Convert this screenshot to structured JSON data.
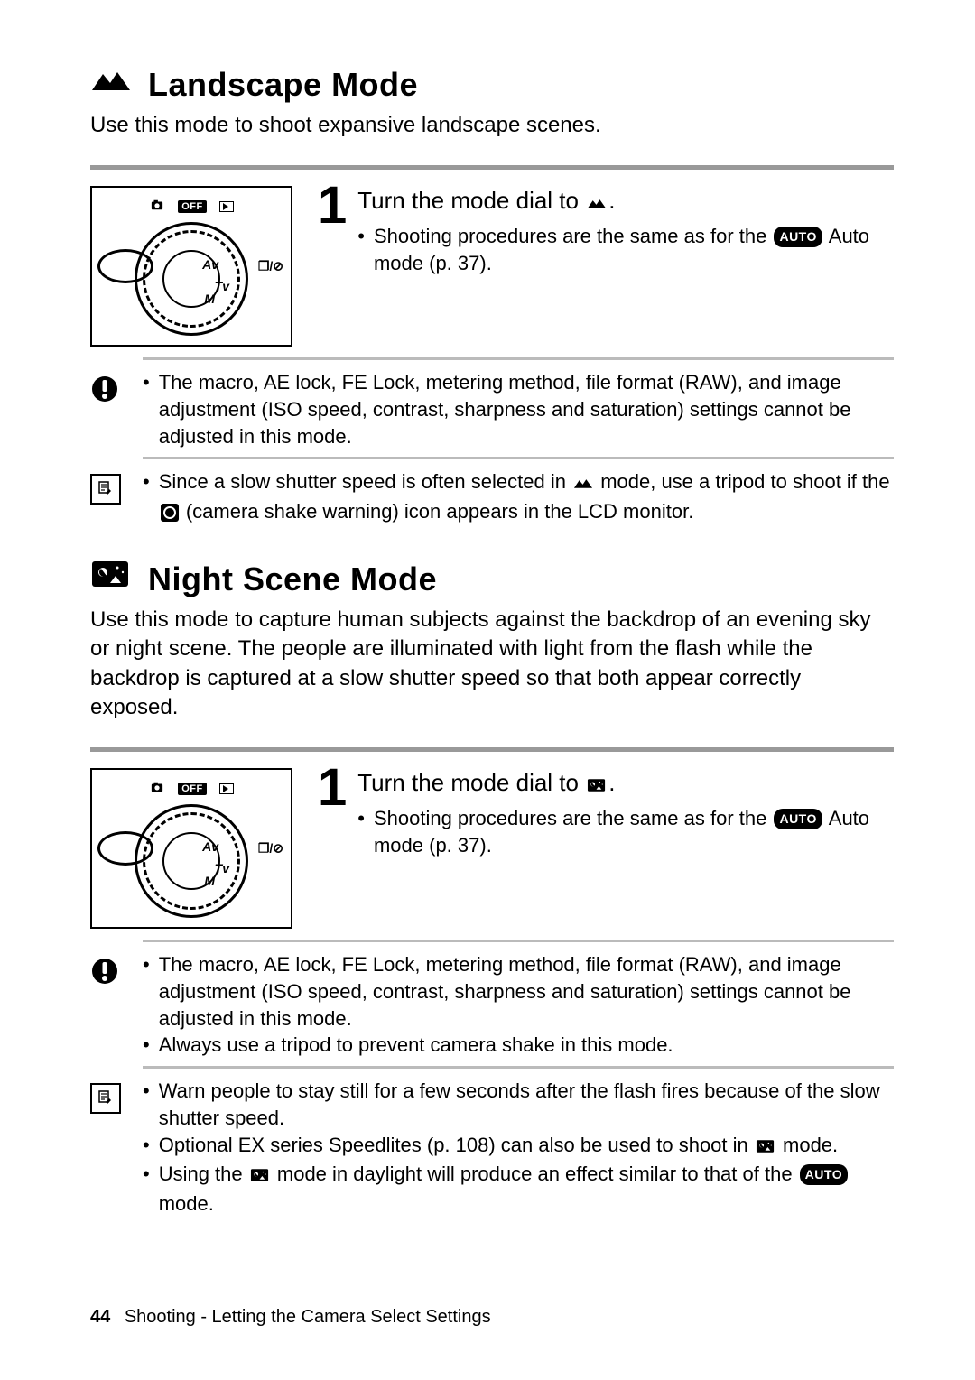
{
  "landscape": {
    "title": "Landscape Mode",
    "desc": "Use this mode to shoot expansive landscape scenes.",
    "step_num": "1",
    "step_title_a": "Turn the mode dial to ",
    "step_title_b": ".",
    "step_bullet_a": "Shooting procedures are the same as for the ",
    "step_bullet_b": " Auto mode (p. 37).",
    "caution": "The macro, AE lock, FE Lock, metering method, file format (RAW), and image adjustment (ISO speed, contrast, sharpness and saturation) settings cannot be adjusted in this mode.",
    "tip_a": "Since a slow shutter speed is often selected in ",
    "tip_b": " mode, use a tripod to shoot if the ",
    "tip_c": " (camera shake warning) icon appears in the LCD monitor."
  },
  "night": {
    "title": "Night Scene Mode",
    "desc": "Use this mode to capture human subjects against the backdrop of an evening sky or night scene. The people are illuminated with light from the flash while the backdrop is captured at a slow shutter speed so that both appear correctly exposed.",
    "step_num": "1",
    "step_title_a": "Turn the mode dial to ",
    "step_title_b": ".",
    "step_bullet_a": "Shooting procedures are the same as for the ",
    "step_bullet_b": " Auto mode (p. 37).",
    "caution1": "The macro, AE lock, FE Lock, metering method, file format (RAW), and image adjustment (ISO speed, contrast, sharpness and saturation) settings cannot be adjusted in this mode.",
    "caution2": "Always use a tripod to prevent camera shake in this mode.",
    "tip1": "Warn people to stay still for a few seconds after the flash fires because of the slow shutter speed.",
    "tip2_a": "Optional EX series Speedlites (p. 108) can also be used to shoot in ",
    "tip2_b": " mode.",
    "tip3_a": "Using the ",
    "tip3_b": " mode in daylight will produce an effect similar to that of the ",
    "tip3_c": " mode."
  },
  "dial": {
    "off": "OFF",
    "side": "❐/⊘",
    "av": "Av",
    "tv": "Tv",
    "m": "M"
  },
  "badges": {
    "auto": "AUTO"
  },
  "footer": {
    "page": "44",
    "text": "Shooting - Letting the Camera Select Settings"
  }
}
